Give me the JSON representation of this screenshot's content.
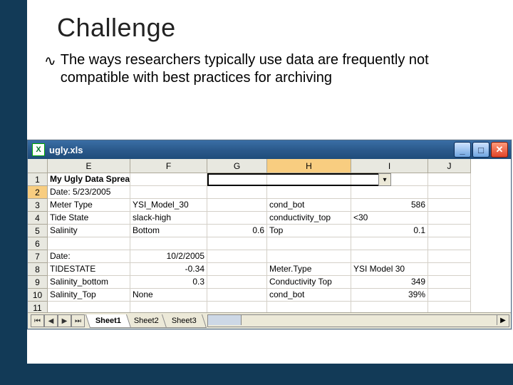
{
  "slide": {
    "title": "Challenge",
    "bullet_glyph": "∿",
    "bullet_text": "The ways researchers typically use data are frequently not compatible with best practices for archiving"
  },
  "excel": {
    "window_title": "ugly.xls",
    "app_icon_letter": "X",
    "columns": [
      "E",
      "F",
      "G",
      "H",
      "I",
      "J"
    ],
    "active_col": "H",
    "active_row": 2,
    "row_numbers": [
      1,
      2,
      3,
      4,
      5,
      6,
      7,
      8,
      9,
      10,
      11
    ],
    "rows": [
      {
        "E": "My Ugly Data Spreadsheet",
        "E_bold": true
      },
      {
        "E": "Date: 5/23/2005"
      },
      {
        "E": "Meter Type",
        "F": "YSI_Model_30",
        "H": "cond_bot",
        "I": "586",
        "I_right": true
      },
      {
        "E": "Tide State",
        "F": "slack-high",
        "H": "conductivity_top",
        "I": "<30"
      },
      {
        "E": "Salinity",
        "F": "Bottom",
        "G": "0.6",
        "G_right": true,
        "H": "Top",
        "I": "0.1",
        "I_right": true
      },
      {},
      {
        "E": "Date:",
        "F": "10/2/2005",
        "F_right": true
      },
      {
        "E": "TIDESTATE",
        "F": "-0.34",
        "F_right": true,
        "H": "Meter.Type",
        "I": "YSI Model 30"
      },
      {
        "E": "Salinity_bottom",
        "F": "0.3",
        "F_right": true,
        "H": "Conductivity Top",
        "I": "349",
        "I_right": true
      },
      {
        "E": "Salinity_Top",
        "F": "None",
        "H": "cond_bot",
        "I": "39%",
        "I_right": true
      },
      {}
    ],
    "sheet_tabs": [
      "Sheet1",
      "Sheet2",
      "Sheet3"
    ],
    "active_sheet": 0
  },
  "chart_data": {
    "type": "table",
    "title": "My Ugly Data Spreadsheet",
    "blocks": [
      {
        "date": "5/23/2005",
        "Meter Type": "YSI_Model_30",
        "Tide State": "slack-high",
        "Salinity Bottom": 0.6,
        "Salinity Top": 0.1,
        "cond_bot": 586,
        "conductivity_top": "<30"
      },
      {
        "date": "10/2/2005",
        "TIDESTATE": -0.34,
        "Salinity_bottom": 0.3,
        "Salinity_Top": "None",
        "Meter.Type": "YSI Model 30",
        "Conductivity Top": 349,
        "cond_bot": "39%"
      }
    ]
  }
}
